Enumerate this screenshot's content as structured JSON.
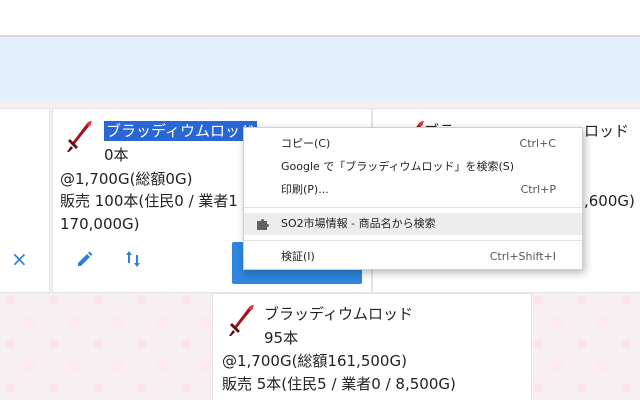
{
  "cards": {
    "left": {
      "close_icon": "×"
    },
    "main": {
      "name": "ブラッディウムロッド",
      "qty": "0本",
      "price": "@1,700G(総額0G)",
      "sale": "販売 100本(住民0 / 業者1",
      "sale_cont": "170,000G)",
      "icons": {
        "edit": "pencil-icon",
        "sort": "swap-vertical-icon"
      }
    },
    "right": {
      "name_partial": "ブラ",
      "name_tail": "ロッド",
      "total_partial": ",600G)"
    },
    "bottom": {
      "name": "ブラッディウムロッド",
      "qty": "95本",
      "price": "@1,700G(総額161,500G)",
      "sale": "販売 5本(住民5 / 業者0 / 8,500G)"
    }
  },
  "context_menu": {
    "items": [
      {
        "label": "コピー(C)",
        "shortcut": "Ctrl+C"
      },
      {
        "label": "Google で「ブラッディウムロッド」を検索(S)",
        "shortcut": ""
      },
      {
        "label": "印刷(P)...",
        "shortcut": "Ctrl+P"
      },
      {
        "label": "SO2市場情報 - 商品名から検索",
        "shortcut": "",
        "icon": "puzzle-icon"
      },
      {
        "label": "検証(I)",
        "shortcut": "Ctrl+Shift+I"
      }
    ]
  },
  "colors": {
    "selection": "#2a67d6",
    "accent": "#2e86de",
    "banner": "#e3f0fb",
    "sword": "#a8141d"
  }
}
